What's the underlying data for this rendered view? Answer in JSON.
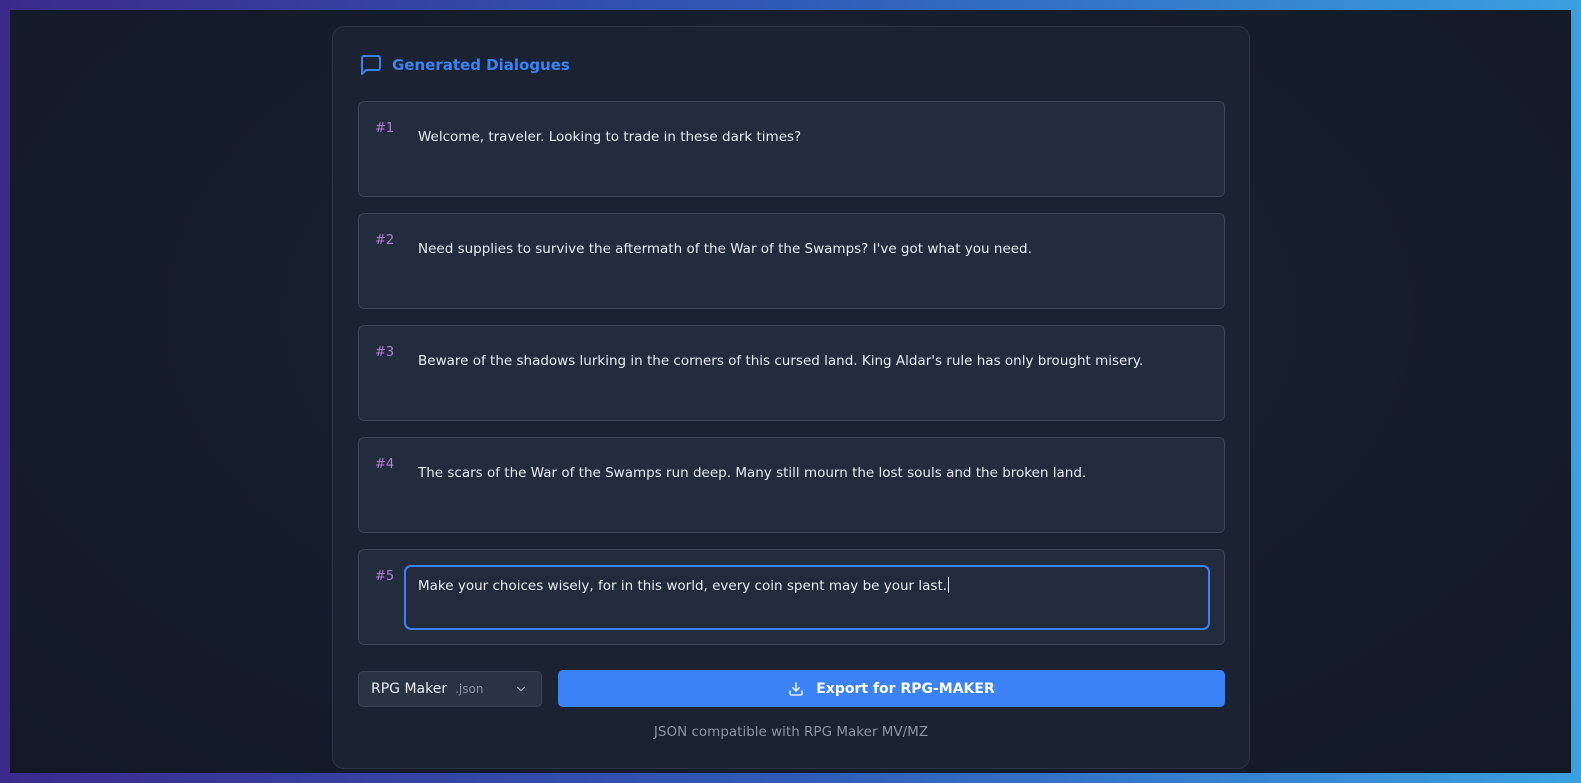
{
  "header": {
    "title": "Generated Dialogues",
    "icon": "message-square-icon"
  },
  "dialogues": [
    {
      "number": "#1",
      "text": "Welcome, traveler. Looking to trade in these dark times?"
    },
    {
      "number": "#2",
      "text": "Need supplies to survive the aftermath of the War of the Swamps? I've got what you need."
    },
    {
      "number": "#3",
      "text": "Beware of the shadows lurking in the corners of this cursed land. King Aldar's rule has only brought misery."
    },
    {
      "number": "#4",
      "text": "The scars of the War of the Swamps run deep. Many still mourn the lost souls and the broken land."
    },
    {
      "number": "#5",
      "text": "Make your choices wisely, for in this world, every coin spent may be your last."
    }
  ],
  "format_select": {
    "label": "RPG Maker",
    "extension": ".json"
  },
  "export_button": {
    "label": "Export for RPG-MAKER",
    "icon": "download-icon"
  },
  "note": "JSON compatible with RPG Maker MV/MZ",
  "colors": {
    "accent": "#3b82f6",
    "number": "#b57bd9",
    "panel": "#1b2333"
  }
}
